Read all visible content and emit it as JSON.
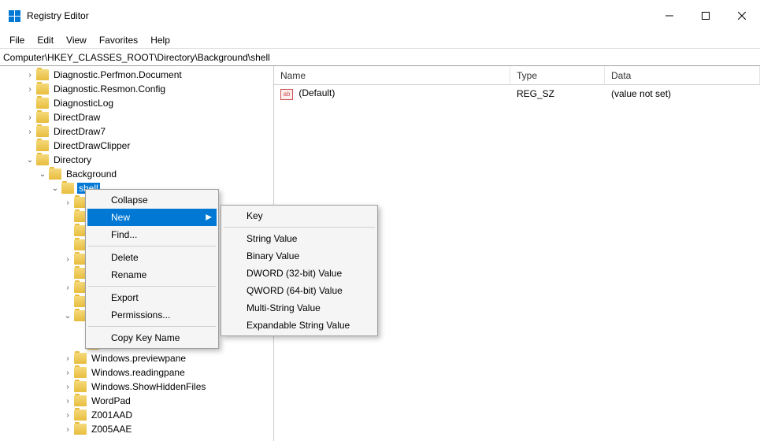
{
  "window": {
    "title": "Registry Editor"
  },
  "menubar": {
    "file": "File",
    "edit": "Edit",
    "view": "View",
    "favorites": "Favorites",
    "help": "Help"
  },
  "address": "Computer\\HKEY_CLASSES_ROOT\\Directory\\Background\\shell",
  "tree": {
    "items": [
      {
        "indent": 2,
        "exp": "right",
        "label": "Diagnostic.Perfmon.Document"
      },
      {
        "indent": 2,
        "exp": "right",
        "label": "Diagnostic.Resmon.Config"
      },
      {
        "indent": 2,
        "exp": "",
        "label": "DiagnosticLog"
      },
      {
        "indent": 2,
        "exp": "right",
        "label": "DirectDraw"
      },
      {
        "indent": 2,
        "exp": "right",
        "label": "DirectDraw7"
      },
      {
        "indent": 2,
        "exp": "",
        "label": "DirectDrawClipper"
      },
      {
        "indent": 2,
        "exp": "down",
        "label": "Directory"
      },
      {
        "indent": 3,
        "exp": "down",
        "label": "Background"
      },
      {
        "indent": 4,
        "exp": "down",
        "label": "shell",
        "selected": true
      },
      {
        "indent": 5,
        "exp": "right",
        "label": ""
      },
      {
        "indent": 5,
        "exp": "",
        "label": ""
      },
      {
        "indent": 5,
        "exp": "",
        "label": ""
      },
      {
        "indent": 5,
        "exp": "",
        "label": ""
      },
      {
        "indent": 5,
        "exp": "right",
        "label": ""
      },
      {
        "indent": 5,
        "exp": "",
        "label": ""
      },
      {
        "indent": 5,
        "exp": "right",
        "label": ""
      },
      {
        "indent": 5,
        "exp": "",
        "label": ""
      },
      {
        "indent": 5,
        "exp": "down",
        "label": ""
      },
      {
        "indent": 6,
        "exp": "",
        "label": ""
      },
      {
        "indent": 6,
        "exp": "",
        "label": ""
      },
      {
        "indent": 5,
        "exp": "right",
        "label": "Windows.previewpane"
      },
      {
        "indent": 5,
        "exp": "right",
        "label": "Windows.readingpane"
      },
      {
        "indent": 5,
        "exp": "right",
        "label": "Windows.ShowHiddenFiles"
      },
      {
        "indent": 5,
        "exp": "right",
        "label": "WordPad"
      },
      {
        "indent": 5,
        "exp": "right",
        "label": "Z001AAD"
      },
      {
        "indent": 5,
        "exp": "right",
        "label": "Z005AAE"
      }
    ]
  },
  "list": {
    "headers": {
      "name": "Name",
      "type": "Type",
      "data": "Data"
    },
    "rows": [
      {
        "name": "(Default)",
        "type": "REG_SZ",
        "data": "(value not set)"
      }
    ]
  },
  "context_menu": {
    "collapse": "Collapse",
    "new": "New",
    "find": "Find...",
    "delete": "Delete",
    "rename": "Rename",
    "export": "Export",
    "permissions": "Permissions...",
    "copy_key_name": "Copy Key Name"
  },
  "submenu": {
    "key": "Key",
    "string_value": "String Value",
    "binary_value": "Binary Value",
    "dword": "DWORD (32-bit) Value",
    "qword": "QWORD (64-bit) Value",
    "multi_string": "Multi-String Value",
    "expandable_string": "Expandable String Value"
  }
}
